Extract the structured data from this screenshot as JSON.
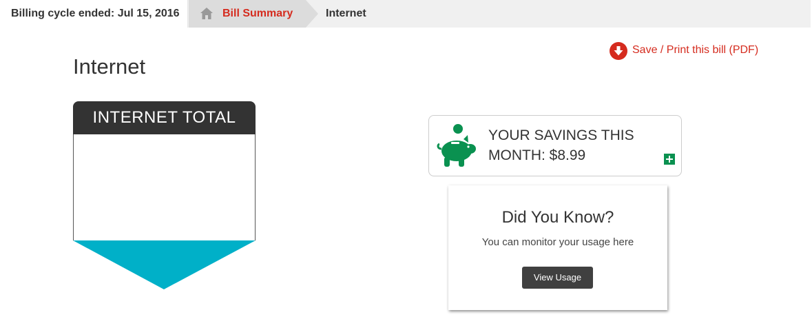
{
  "breadcrumb": {
    "cycle_text": "Billing cycle ended: Jul 15, 2016",
    "bill_summary": "Bill Summary",
    "current": "Internet",
    "home_icon": "home-icon"
  },
  "save_link": {
    "label": "Save / Print this bill (PDF)",
    "icon": "download-arrow-icon"
  },
  "page_title": "Internet",
  "internet_total": {
    "heading": "INTERNET TOTAL"
  },
  "savings": {
    "line1": "YOUR SAVINGS THIS",
    "line2": "MONTH: $8.99",
    "icon": "piggy-bank-icon",
    "expand_icon": "plus-icon"
  },
  "did_you_know": {
    "heading": "Did You Know?",
    "text": "You can monitor your usage here",
    "button": "View Usage"
  },
  "colors": {
    "accent_red": "#d52b1e",
    "savings_green": "#0a9150",
    "badge_teal": "#00b0c8",
    "dark": "#333333"
  }
}
